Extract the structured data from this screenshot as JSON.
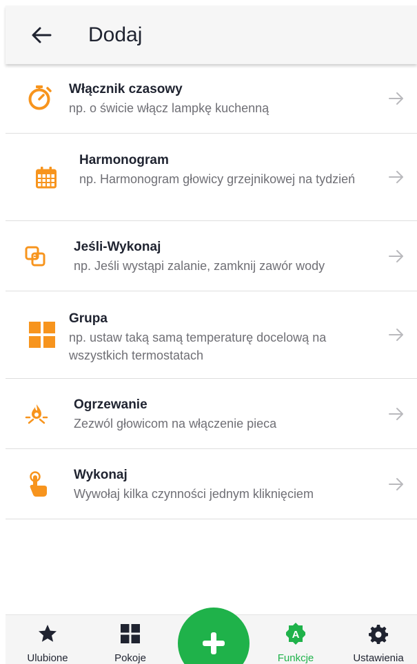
{
  "header": {
    "title": "Dodaj"
  },
  "items": [
    {
      "title": "Włącznik czasowy",
      "description": "np. o świcie włącz lampkę kuchenną",
      "icon": "stopwatch-icon"
    },
    {
      "title": "Harmonogram",
      "description": "np. Harmonogram głowicy grzejnikowej na tydzień",
      "icon": "calendar-icon"
    },
    {
      "title": "Jeśli-Wykonaj",
      "description": "np. Jeśli wystąpi zalanie, zamknij zawór wody",
      "icon": "if-then-icon"
    },
    {
      "title": "Grupa",
      "description": "np. ustaw taką samą temperaturę docelową na wszystkich termostatach",
      "icon": "grid-icon"
    },
    {
      "title": "Ogrzewanie",
      "description": "Zezwól głowicom na włączenie pieca",
      "icon": "flame-icon"
    },
    {
      "title": "Wykonaj",
      "description": "Wywołaj kilka czynności jednym kliknięciem",
      "icon": "tap-hand-icon"
    }
  ],
  "nav": {
    "favorites": "Ulubione",
    "rooms": "Pokoje",
    "functions": "Funkcje",
    "settings": "Ustawienia"
  },
  "colors": {
    "accent": "#f7941d",
    "green": "#1fb24a",
    "text": "#1f2330",
    "muted": "#6f6f75"
  }
}
